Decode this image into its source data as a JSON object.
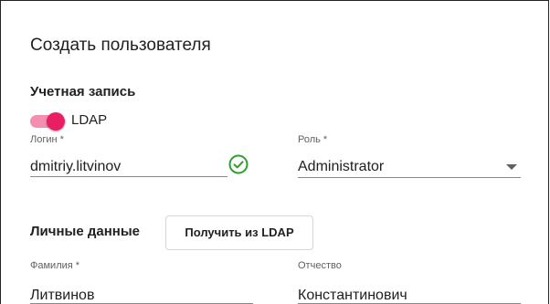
{
  "dialog": {
    "title": "Создать пользователя"
  },
  "account": {
    "section_title": "Учетная запись",
    "ldap_toggle": {
      "label": "LDAP",
      "checked": true
    },
    "login": {
      "label": "Логин *",
      "value": "dmitriy.litvinov",
      "status_icon": "check-circle-icon"
    },
    "role": {
      "label": "Роль *",
      "value": "Administrator",
      "icon": "chevron-down-icon"
    }
  },
  "personal": {
    "section_title": "Личные данные",
    "fetch_ldap_button": "Получить из LDAP",
    "surname": {
      "label": "Фамилия *",
      "value": "Литвинов"
    },
    "patronymic": {
      "label": "Отчество",
      "value": "Константинович"
    }
  },
  "colors": {
    "accent": "#e91e63",
    "accent_track": "#f48fb1",
    "success": "#2e9e2e"
  }
}
